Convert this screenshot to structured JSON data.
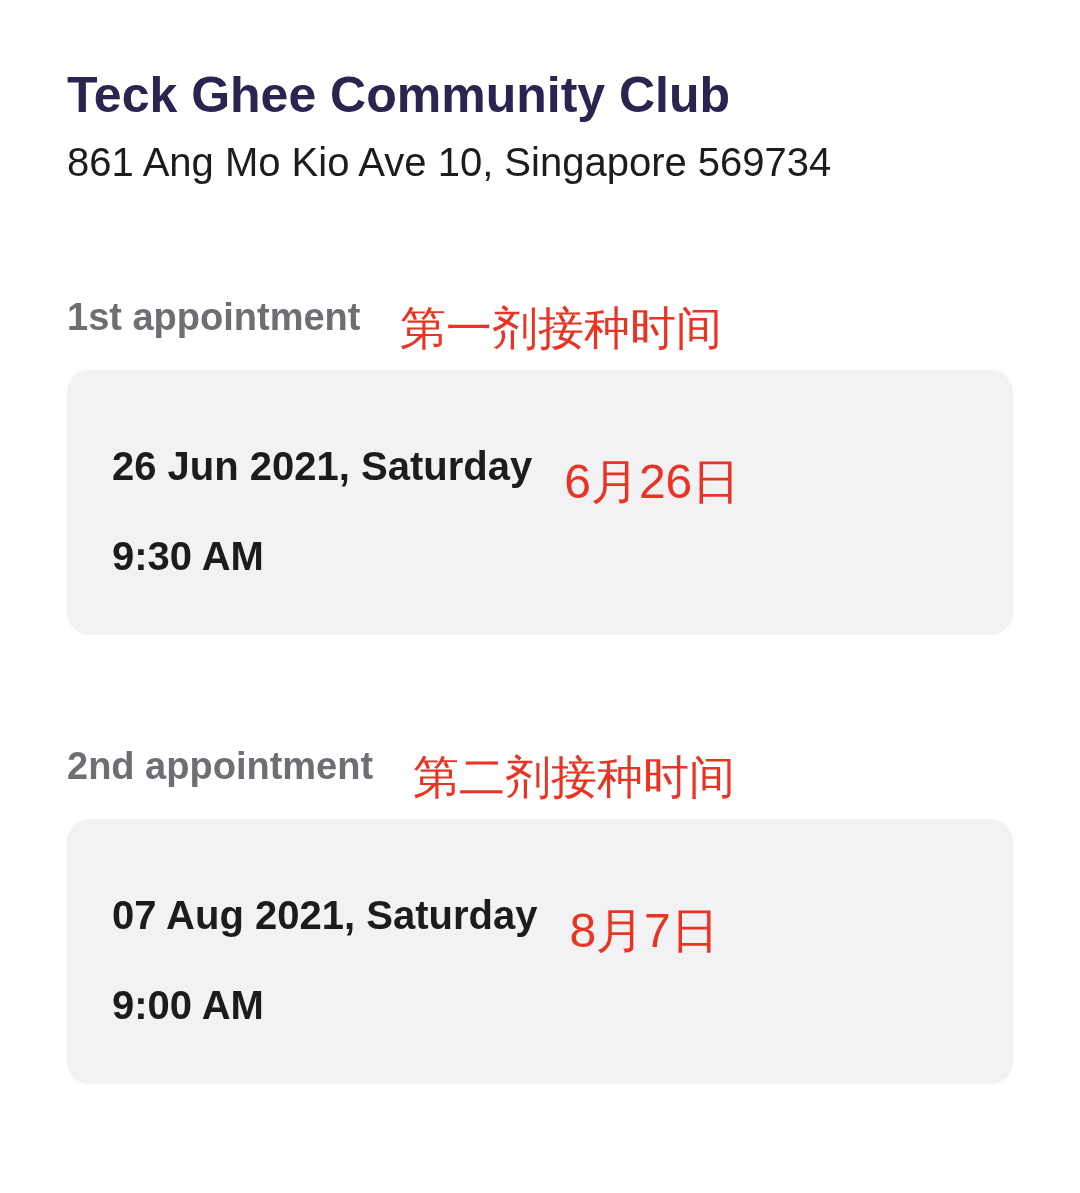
{
  "venue": {
    "name": "Teck Ghee Community Club",
    "address": "861 Ang Mo Kio Ave 10, Singapore 569734"
  },
  "appointments": [
    {
      "label": "1st appointment",
      "label_note": "第一剂接种时间",
      "date": "26 Jun 2021, Saturday",
      "date_note": "6月26日",
      "time": "9:30 AM"
    },
    {
      "label": "2nd appointment",
      "label_note": "第二剂接种时间",
      "date": "07 Aug 2021, Saturday",
      "date_note": "8月7日",
      "time": "9:00 AM"
    }
  ]
}
